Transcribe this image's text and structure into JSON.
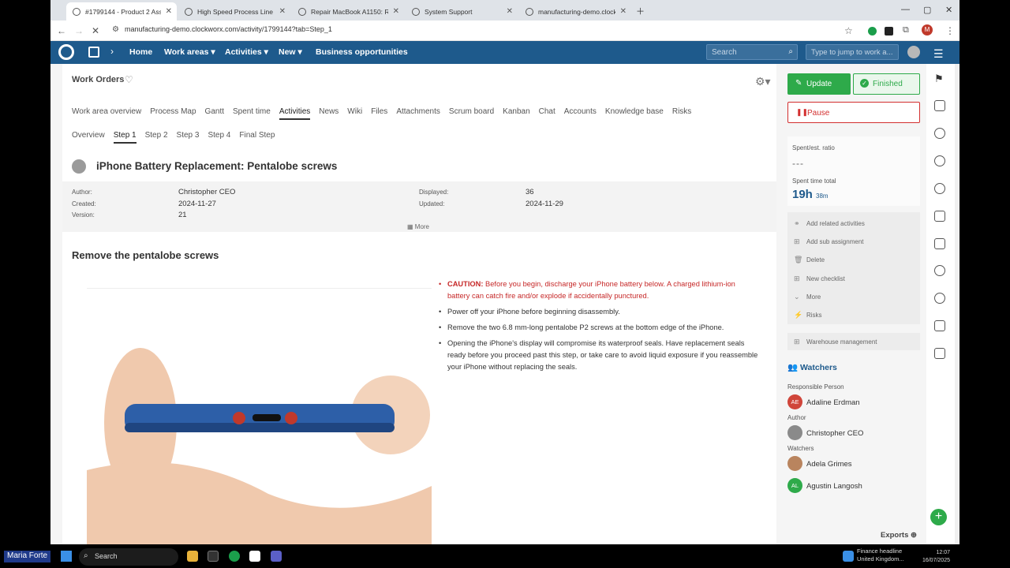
{
  "browser": {
    "tabs": [
      {
        "title": "#1799144 - Product 2 Assembl",
        "active": true
      },
      {
        "title": "High Speed Process Line Princ",
        "active": false
      },
      {
        "title": "Repair MacBook A1150: Remov",
        "active": false
      },
      {
        "title": "System Support",
        "active": false
      },
      {
        "title": "manufacturing-demo.clockworx",
        "active": false
      }
    ],
    "url": "manufacturing-demo.clockworx.com/activity/1799144?tab=Step_1",
    "profile_initial": "M"
  },
  "appnav": {
    "items": [
      "Home",
      "Work areas",
      "Activities",
      "New",
      "Business opportunities"
    ],
    "search_placeholder": "Search",
    "jump_placeholder": "Type to jump to work a...",
    "accent": "#1e5a8c"
  },
  "page": {
    "breadcrumb": "Work Orders",
    "tabs": [
      "Work area overview",
      "Process Map",
      "Gantt",
      "Spent time",
      "Activities",
      "News",
      "Wiki",
      "Files",
      "Attachments",
      "Scrum board",
      "Kanban",
      "Chat",
      "Accounts",
      "Knowledge base",
      "Risks"
    ],
    "active_tab": "Activities",
    "steps": [
      "Overview",
      "Step 1",
      "Step 2",
      "Step 3",
      "Step 4",
      "Final Step"
    ],
    "active_step": "Step 1",
    "title": "iPhone Battery Replacement: Pentalobe screws",
    "meta": {
      "author_label": "Author:",
      "author": "Christopher CEO",
      "created_label": "Created:",
      "created": "2024-11-27",
      "version_label": "Version:",
      "version": "21",
      "displayed_label": "Displayed:",
      "displayed": "36",
      "updated_label": "Updated:",
      "updated": "2024-11-29"
    },
    "more_label": "More",
    "section_title": "Remove the pentalobe screws",
    "bullets": {
      "caution_prefix": "CAUTION:",
      "caution_text": " Before you begin, discharge your iPhone battery below. A charged lithium-ion battery can catch fire and/or explode if accidentally punctured.",
      "b2": "Power off your iPhone before beginning disassembly.",
      "b3": "Remove the two 6.8 mm-long pentalobe P2 screws at the bottom edge of the iPhone.",
      "b4": "Opening the iPhone's display will compromise its waterproof seals. Have replacement seals ready before you proceed past this step, or take care to avoid liquid exposure if you reassemble your iPhone without replacing the seals."
    },
    "caution_color": "#c62828"
  },
  "sidebar": {
    "update": "Update",
    "finished": "Finished",
    "pause": "Pause",
    "ratio_label": "Spent/est. ratio",
    "ratio_value": "---",
    "spent_label": "Spent time total",
    "spent_hours": "19h",
    "spent_minutes": "38m",
    "actions": [
      "Add related activities",
      "Add sub assignment",
      "Delete",
      "New checklist",
      "More",
      "Risks"
    ],
    "warehouse": "Warehouse management",
    "watchers_title": "Watchers",
    "responsible_label": "Responsible Person",
    "responsible": {
      "initials": "AE",
      "name": "Adaline Erdman"
    },
    "author_label": "Author",
    "author": "Christopher CEO",
    "watchers_label": "Watchers",
    "watchers": [
      {
        "name": "Adela Grimes"
      },
      {
        "initials": "AL",
        "name": "Agustin Langosh"
      }
    ],
    "exports": "Exports",
    "green": "#2eaa4a",
    "red": "#d32f2f"
  },
  "taskbar": {
    "user": "Maria Forte",
    "search": "Search",
    "news_title": "Finance headline",
    "news_sub": "United Kingdom...",
    "time": "12:07",
    "date": "16/07/2025"
  }
}
